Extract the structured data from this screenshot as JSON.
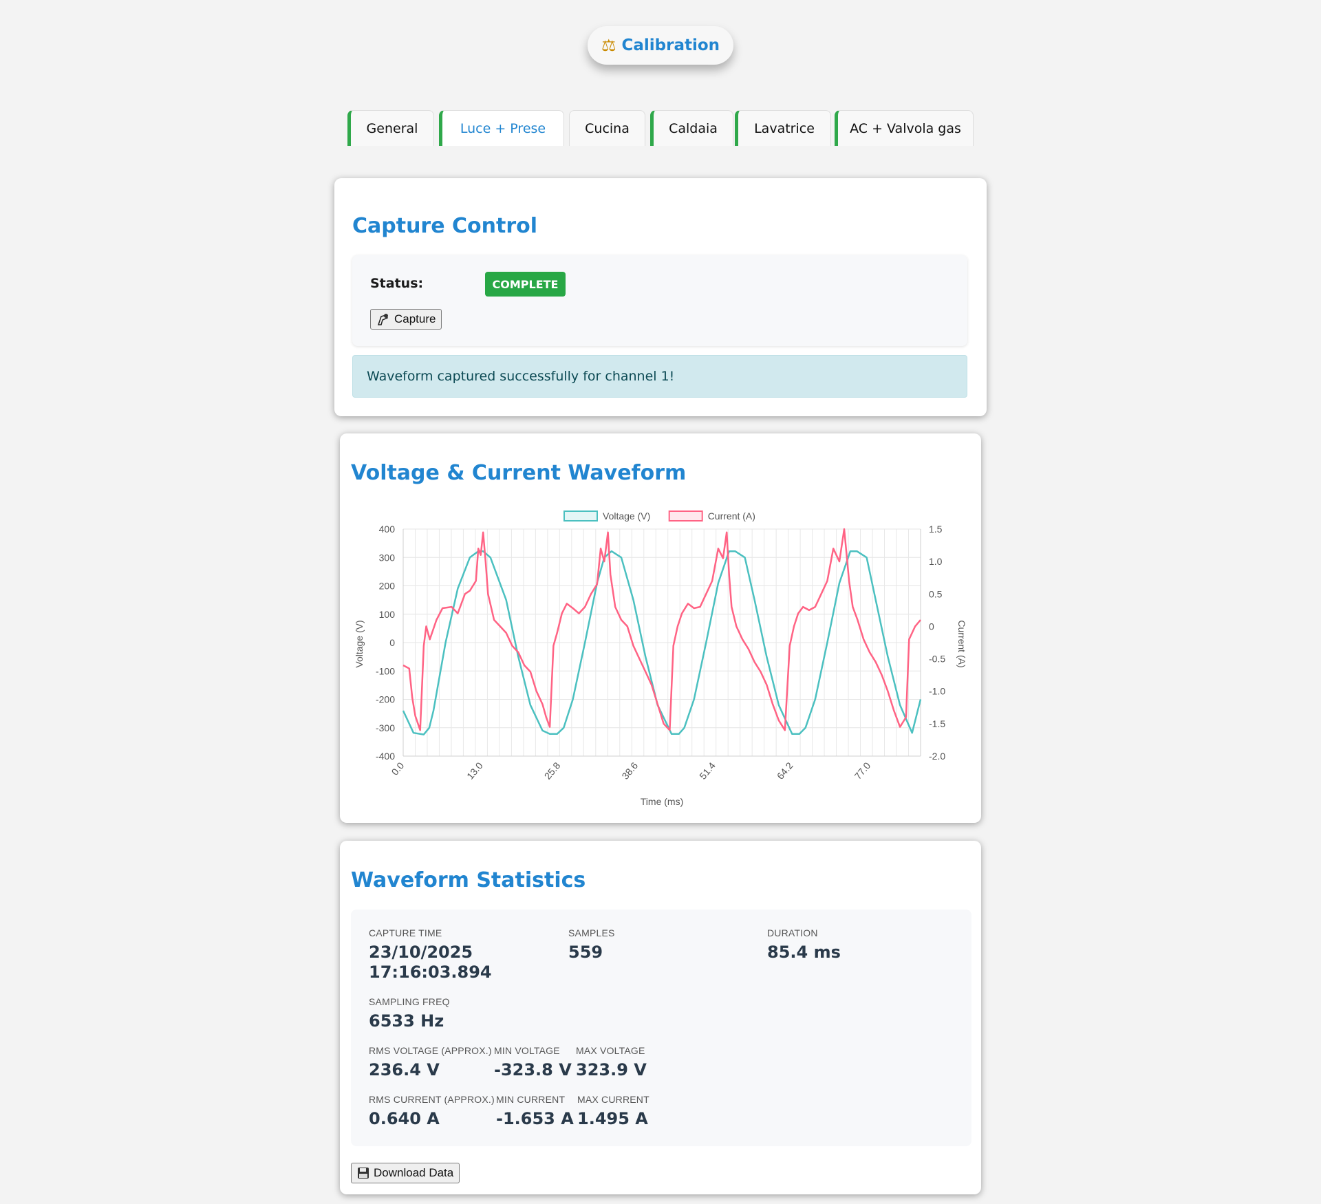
{
  "header": {
    "title": "Calibration",
    "icon": "balance-scale-icon"
  },
  "tabs": [
    {
      "label": "General",
      "active": false
    },
    {
      "label": "Luce + Prese",
      "active": true
    },
    {
      "label": "Cucina",
      "active": false
    },
    {
      "label": "Caldaia",
      "active": false
    },
    {
      "label": "Lavatrice",
      "active": false
    },
    {
      "label": "AC + Valvola gas",
      "active": false
    }
  ],
  "capture": {
    "title": "Capture Control",
    "status_label": "Status:",
    "status_value": "COMPLETE",
    "capture_button": "Capture",
    "capture_icon": "camera-icon",
    "message": "Waveform captured successfully for channel 1!"
  },
  "waveform": {
    "title": "Voltage & Current Waveform"
  },
  "chart_data": {
    "type": "line",
    "title": "",
    "xlabel": "Time (ms)",
    "ylabel": "Voltage (V)",
    "y2label": "Current (A)",
    "ylim": [
      -400,
      400
    ],
    "y2lim": [
      -2.0,
      1.5
    ],
    "xlim": [
      0,
      85.4
    ],
    "x_ticks": [
      "0.0",
      "13.0",
      "25.8",
      "38.6",
      "51.4",
      "64.2",
      "77.0"
    ],
    "y_ticks": [
      "400",
      "300",
      "200",
      "100",
      "0",
      "-100",
      "-200",
      "-300",
      "-400"
    ],
    "y2_ticks": [
      "1.5",
      "1.0",
      "0.5",
      "0",
      "-0.5",
      "-1.0",
      "-1.5",
      "-2.0"
    ],
    "legend_position": "top",
    "grid": true,
    "series": [
      {
        "name": "Voltage (V)",
        "axis": "left",
        "color": "#4bc0c0",
        "x": [
          0,
          1.7,
          3.4,
          4.3,
          5,
          7,
          9,
          11,
          12.4,
          13.2,
          14.4,
          17,
          19,
          21,
          23,
          24.2,
          25.4,
          26.5,
          28,
          30,
          32,
          33.2,
          34.4,
          36,
          38,
          40,
          42,
          44.3,
          45.5,
          46.4,
          48,
          50,
          52,
          53.8,
          54.8,
          56.4,
          58,
          60,
          62,
          64.2,
          65.4,
          66.4,
          68,
          70,
          72,
          73.8,
          74.9,
          76.5,
          78,
          80,
          82,
          84,
          85.4
        ],
        "y": [
          -240,
          -318,
          -324,
          -300,
          -240,
          0,
          190,
          300,
          322,
          322,
          300,
          150,
          -50,
          -220,
          -310,
          -322,
          -322,
          -300,
          -200,
          0,
          210,
          300,
          322,
          300,
          150,
          -50,
          -220,
          -322,
          -322,
          -300,
          -200,
          0,
          210,
          322,
          322,
          300,
          150,
          -50,
          -220,
          -322,
          -322,
          -300,
          -200,
          0,
          210,
          322,
          322,
          300,
          150,
          -50,
          -220,
          -318,
          -200
        ]
      },
      {
        "name": "Current (A)",
        "axis": "right",
        "color": "#ff6384",
        "x": [
          0,
          1,
          1.5,
          2,
          2.8,
          3.4,
          3.8,
          4.4,
          5.5,
          6.5,
          8,
          9,
          10.2,
          11,
          12,
          12.4,
          12.8,
          13.2,
          13.6,
          14,
          15,
          16,
          17,
          18,
          19,
          20,
          21,
          22,
          23,
          23.6,
          24.2,
          24.8,
          25.4,
          26.2,
          27,
          28,
          29,
          30,
          31,
          32,
          32.6,
          33.2,
          33.8,
          34.2,
          35,
          36,
          37,
          38,
          39,
          40,
          41,
          42,
          43,
          44,
          44.6,
          45.3,
          46,
          47,
          48,
          49,
          50,
          51,
          52,
          52.8,
          53.4,
          53.8,
          54.2,
          55,
          56,
          57,
          58,
          59,
          60,
          61,
          62,
          63,
          63.8,
          64.5,
          65.2,
          66,
          67,
          68,
          69,
          70,
          71,
          72,
          72.8,
          73.6,
          74.2,
          75,
          76,
          77,
          78,
          79,
          80,
          81,
          82,
          83,
          83.5,
          84,
          84.5,
          85.4
        ],
        "y": [
          -0.6,
          -0.65,
          -1.1,
          -1.38,
          -1.6,
          -0.3,
          0.0,
          -0.2,
          0.1,
          0.28,
          0.3,
          0.2,
          0.5,
          0.55,
          0.7,
          1.2,
          1.1,
          1.45,
          1.0,
          0.5,
          0.1,
          0.0,
          -0.1,
          -0.3,
          -0.4,
          -0.6,
          -0.7,
          -1.0,
          -1.2,
          -1.4,
          -1.55,
          -0.3,
          -0.1,
          0.2,
          0.35,
          0.28,
          0.2,
          0.3,
          0.5,
          0.65,
          1.2,
          1.0,
          1.45,
          0.8,
          0.3,
          0.1,
          0.0,
          -0.3,
          -0.5,
          -0.7,
          -0.9,
          -1.2,
          -1.5,
          -1.6,
          -0.3,
          0.0,
          0.2,
          0.35,
          0.28,
          0.3,
          0.5,
          0.7,
          1.2,
          1.05,
          1.45,
          0.8,
          0.3,
          0.0,
          -0.2,
          -0.35,
          -0.55,
          -0.7,
          -0.9,
          -1.2,
          -1.45,
          -1.6,
          -0.3,
          0.0,
          0.2,
          0.3,
          0.25,
          0.3,
          0.5,
          0.7,
          1.2,
          1.0,
          1.5,
          0.7,
          0.3,
          0.1,
          -0.2,
          -0.4,
          -0.55,
          -0.75,
          -1.0,
          -1.3,
          -1.55,
          -1.4,
          -0.2,
          -0.1,
          0.0,
          0.1
        ]
      }
    ]
  },
  "stats": {
    "title": "Waveform Statistics",
    "capture_time_label": "Capture Time",
    "capture_time_line1": "23/10/2025",
    "capture_time_line2": "17:16:03.894",
    "samples_label": "Samples",
    "samples": "559",
    "duration_label": "Duration",
    "duration": "85.4 ms",
    "sampling_freq_label": "Sampling Freq",
    "sampling_freq": "6533 Hz",
    "rms_voltage_label": "RMS Voltage (approx.)",
    "rms_voltage": "236.4 V",
    "min_voltage_label": "Min Voltage",
    "min_voltage": "-323.8 V",
    "max_voltage_label": "Max Voltage",
    "max_voltage": "323.9 V",
    "rms_current_label": "RMS Current (approx.)",
    "rms_current": "0.640 A",
    "min_current_label": "Min Current",
    "min_current": "-1.653 A",
    "max_current_label": "Max Current",
    "max_current": "1.495 A",
    "download_button": "Download Data",
    "download_icon": "floppy-disk-icon"
  }
}
